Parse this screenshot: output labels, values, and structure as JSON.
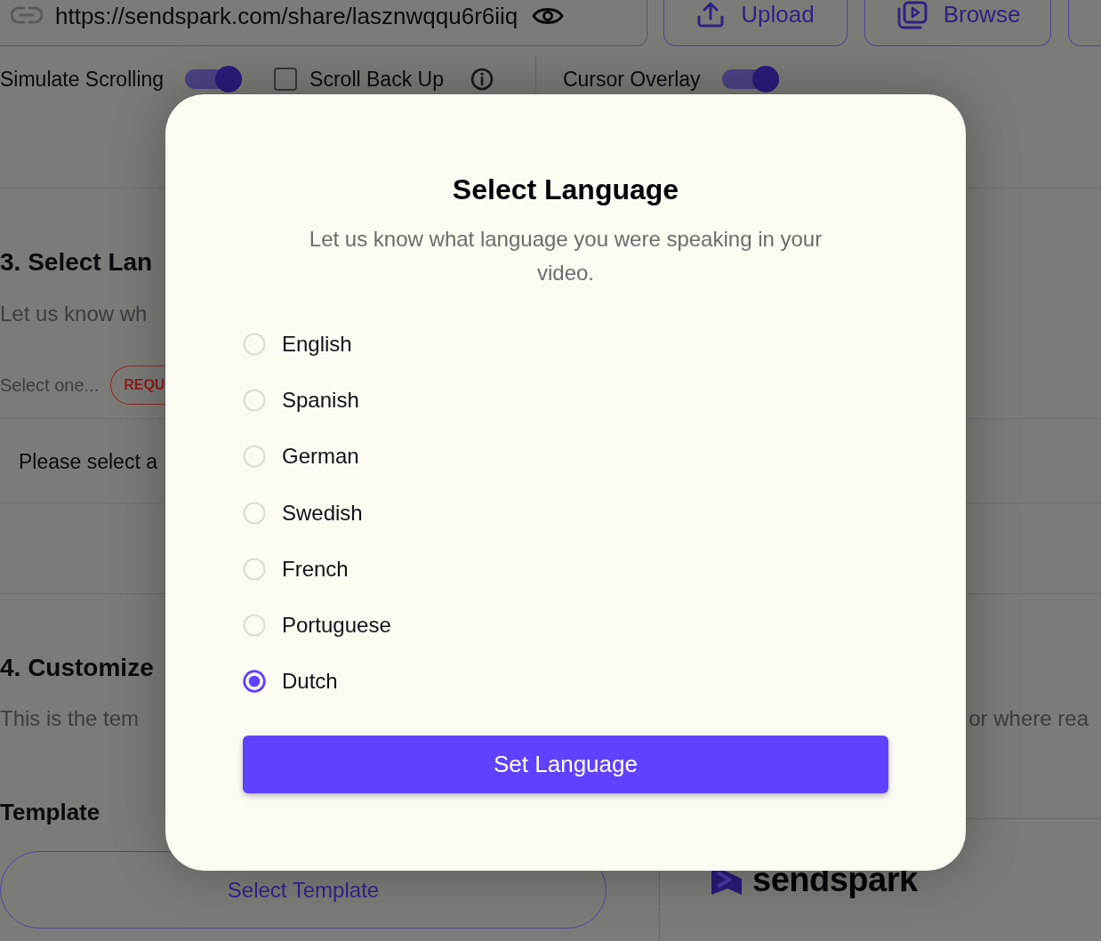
{
  "background_page": {
    "url_bar": {
      "value": "https://sendspark.com/share/lasznwqqu6r6iiq"
    },
    "toolbar_buttons": [
      {
        "kind": "upload",
        "label": "Upload"
      },
      {
        "kind": "browse",
        "label": "Browse"
      },
      {
        "kind": "partial"
      }
    ],
    "option_groups": [
      [
        {
          "kind": "toggle",
          "label": "Simulate Scrolling",
          "on": true
        },
        {
          "kind": "checkbox",
          "label": "Scroll Back Up",
          "checked": false,
          "info": true
        }
      ],
      [
        {
          "kind": "toggle",
          "label": "Cursor Overlay",
          "on": true
        }
      ]
    ],
    "language_section": {
      "heading": "3. Select Lan",
      "description": "Let us know wh",
      "select_placeholder": "Select one...",
      "badge": "REQU",
      "notice": "Please select a"
    },
    "customize_section": {
      "heading": "4. Customize",
      "description": "This is the tem",
      "description_continued": "or where rea",
      "template_label": "Template",
      "template_button": "Select Template"
    },
    "logo": {
      "wordmark": "sendspark"
    }
  },
  "dialog": {
    "title": "Select Language",
    "subtitle": "Let us know what language you were speaking in your video.",
    "languages": [
      {
        "label": "English",
        "selected": false
      },
      {
        "label": "Spanish",
        "selected": false
      },
      {
        "label": "German",
        "selected": false
      },
      {
        "label": "Swedish",
        "selected": false
      },
      {
        "label": "French",
        "selected": false
      },
      {
        "label": "Portuguese",
        "selected": false
      },
      {
        "label": "Dutch",
        "selected": true
      }
    ],
    "submit_button": "Set Language"
  }
}
